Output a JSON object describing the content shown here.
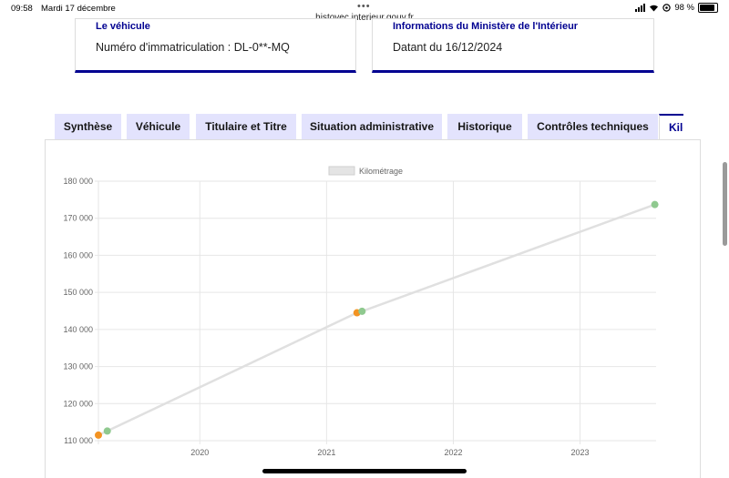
{
  "status_bar": {
    "time": "09:58",
    "date": "Mardi 17 décembre",
    "dots": "•••",
    "battery": "98 %"
  },
  "browser": {
    "url": "histovec.interieur.gouv.fr"
  },
  "cards": [
    {
      "title": "Le véhicule",
      "text": "Numéro d'immatriculation : DL-0**-MQ"
    },
    {
      "title": "Informations du Ministère de l'Intérieur",
      "text": "Datant du 16/12/2024"
    }
  ],
  "tabs": [
    {
      "label": "Synthèse"
    },
    {
      "label": "Véhicule"
    },
    {
      "label": "Titulaire et Titre"
    },
    {
      "label": "Situation administrative"
    },
    {
      "label": "Historique"
    },
    {
      "label": "Contrôles techniques"
    },
    {
      "label": "Kilométrage"
    }
  ],
  "colors": {
    "accent": "#000091",
    "tab_bg": "#e3e3fd",
    "point_green": "#8fc98f",
    "point_orange": "#f39322",
    "line": "#e0e0e0"
  },
  "chart_data": {
    "type": "line",
    "legend": "Kilométrage",
    "legend_position": "top-center",
    "grid": true,
    "x_ticks": [
      "2020",
      "2021",
      "2022",
      "2023"
    ],
    "y_ticks": [
      "110 000",
      "120 000",
      "130 000",
      "140 000",
      "150 000",
      "160 000",
      "170 000",
      "180 000"
    ],
    "ylim": [
      110000,
      180000
    ],
    "xlim": [
      2019.2,
      2023.6
    ],
    "points": [
      {
        "x": 2019.2,
        "y": 111500,
        "color": "orange"
      },
      {
        "x": 2019.27,
        "y": 112600,
        "color": "green"
      },
      {
        "x": 2021.24,
        "y": 144500,
        "color": "orange"
      },
      {
        "x": 2021.28,
        "y": 144900,
        "color": "green"
      },
      {
        "x": 2023.59,
        "y": 173700,
        "color": "green"
      }
    ]
  }
}
